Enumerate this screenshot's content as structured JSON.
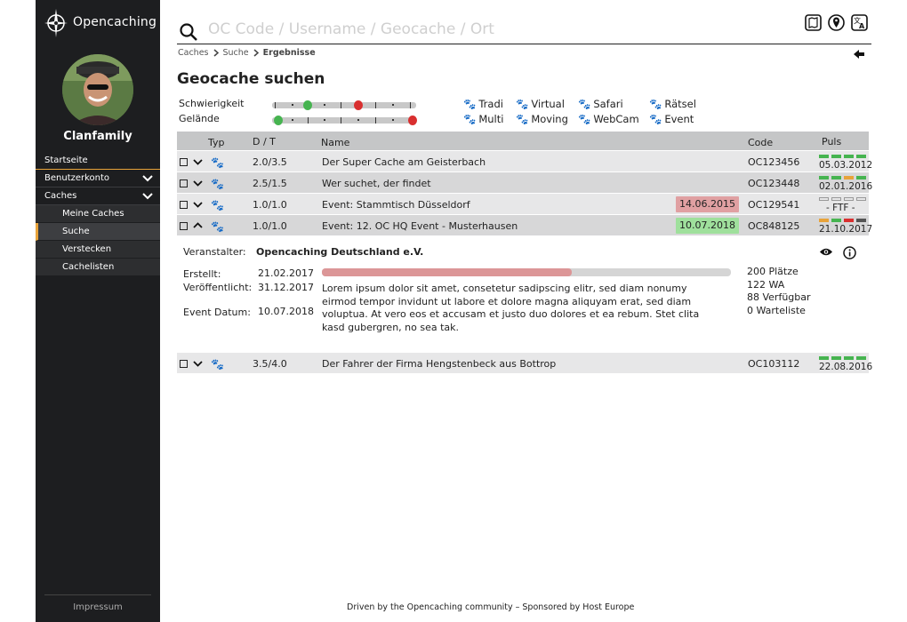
{
  "brand": {
    "name": "Opencaching"
  },
  "user": {
    "name": "Clanfamily"
  },
  "nav": {
    "items": [
      {
        "label": "Startseite"
      },
      {
        "label": "Benutzerkonto"
      },
      {
        "label": "Caches"
      }
    ],
    "sub": [
      {
        "label": "Meine Caches"
      },
      {
        "label": "Suche"
      },
      {
        "label": "Verstecken"
      },
      {
        "label": "Cachelisten"
      }
    ],
    "impressum": "Impressum"
  },
  "search": {
    "placeholder": "OC Code / Username / Geocache / Ort"
  },
  "breadcrumb": [
    "Caches",
    "Suche",
    "Ergebnisse"
  ],
  "page_title": "Geocache suchen",
  "filters": {
    "difficulty_label": "Schwierigkeit",
    "terrain_label": "Gelände",
    "difficulty_range": [
      1.5,
      3.5
    ],
    "terrain_range": [
      1,
      5
    ]
  },
  "types": [
    "Tradi",
    "Virtual",
    "Safari",
    "Rätsel",
    "Multi",
    "Moving",
    "WebCam",
    "Event"
  ],
  "columns": {
    "typ": "Typ",
    "dt": "D / T",
    "name": "Name",
    "code": "Code",
    "puls": "Puls"
  },
  "rows": [
    {
      "dt": "2.0/3.5",
      "name": "Der Super Cache am Geisterbach",
      "code": "OC123456",
      "puls_date": "05.03.2012",
      "badge": ""
    },
    {
      "dt": "2.5/1.5",
      "name": "Wer suchet, der findet",
      "code": "OC123448",
      "puls_date": "02.01.2016",
      "badge": ""
    },
    {
      "dt": "1.0/1.0",
      "name": "Event: Stammtisch Düsseldorf",
      "code": "OC129541",
      "puls_date": "- FTF -",
      "badge": "14.06.2015"
    },
    {
      "dt": "1.0/1.0",
      "name": "Event: 12. OC HQ Event - Musterhausen",
      "code": "OC848125",
      "puls_date": "21.10.2017",
      "badge": "10.07.2018"
    },
    {
      "dt": "3.5/4.0",
      "name": "Der Fahrer der Firma Hengstenbeck aus Bottrop",
      "code": "OC103112",
      "puls_date": "22.08.2016",
      "badge": ""
    }
  ],
  "detail": {
    "organizer_label": "Veranstalter:",
    "organizer": "Opencaching Deutschland e.V.",
    "created_label": "Erstellt:",
    "created": "21.02.2017",
    "published_label": "Veröffentlicht:",
    "published": "31.12.2017",
    "event_label": "Event Datum:",
    "event_date": "10.07.2018",
    "progress": 0.61,
    "description": "Lorem ipsum dolor sit amet, consetetur sadipscing elitr, sed diam nonumy eirmod tempor invidunt ut labore et dolore magna aliquyam erat, sed diam voluptua. At vero eos et accusam et justo duo dolores et ea rebum. Stet clita kasd gubergren, no sea tak.",
    "places": "200 Plätze",
    "wa": "122 WA",
    "available": "88 Verfügbar",
    "waitlist": "0 Warteliste"
  },
  "footer": "Driven by the Opencaching community  –  Sponsored by Host Europe",
  "colors": {
    "sidebar": "#1d1e20",
    "accent": "#e8a33a",
    "green": "#46b450",
    "red": "#d92f2f",
    "pink": "#e0a0a2",
    "lightgreen": "#9fe09c"
  }
}
